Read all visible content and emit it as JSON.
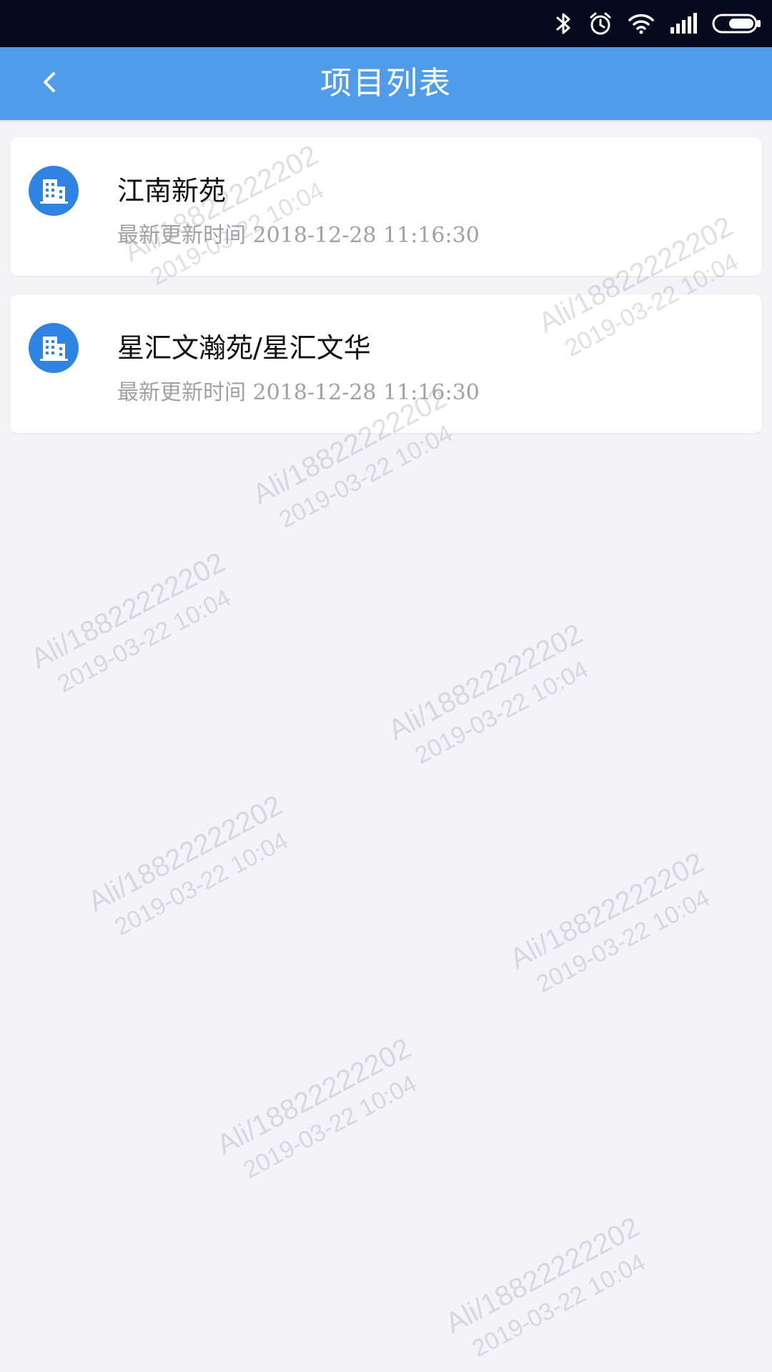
{
  "header": {
    "title": "项目列表"
  },
  "projects": [
    {
      "name": "江南新苑",
      "time_label": "最新更新时间",
      "time_value": "2018-12-28 11:16:30"
    },
    {
      "name": "星汇文瀚苑/星汇文华",
      "time_label": "最新更新时间",
      "time_value": "2018-12-28 11:16:30"
    }
  ],
  "watermark": {
    "line1": "Ali/18822222202",
    "line2": "2019-03-22 10:04"
  },
  "icons": {
    "status": [
      "bluetooth-icon",
      "alarm-icon",
      "wifi-icon",
      "signal-icon",
      "battery-icon"
    ],
    "back": "chevron-left-icon",
    "project": "building-icon"
  },
  "colors": {
    "header": "#4f9cea",
    "status_bar": "#050a1f",
    "icon_blue": "#2f84e3",
    "background": "#f3f3f8"
  }
}
